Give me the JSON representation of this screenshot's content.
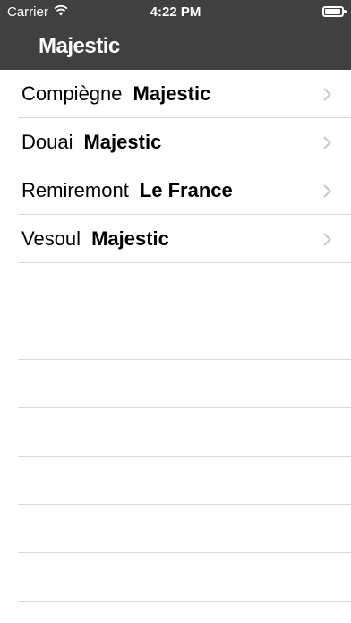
{
  "status_bar": {
    "carrier": "Carrier",
    "time": "4:22 PM",
    "wifi_icon": "wifi-icon",
    "battery_icon": "battery-icon",
    "battery_level": 0.95
  },
  "nav": {
    "title": "Majestic"
  },
  "rows": [
    {
      "city": "Compiègne",
      "cinema": "Majestic"
    },
    {
      "city": "Douai",
      "cinema": "Majestic"
    },
    {
      "city": "Remiremont",
      "cinema": "Le France"
    },
    {
      "city": "Vesoul",
      "cinema": "Majestic"
    }
  ],
  "colors": {
    "bar": "#404040",
    "separator": "#d9d9d9",
    "chevron": "#c7c7cc"
  }
}
